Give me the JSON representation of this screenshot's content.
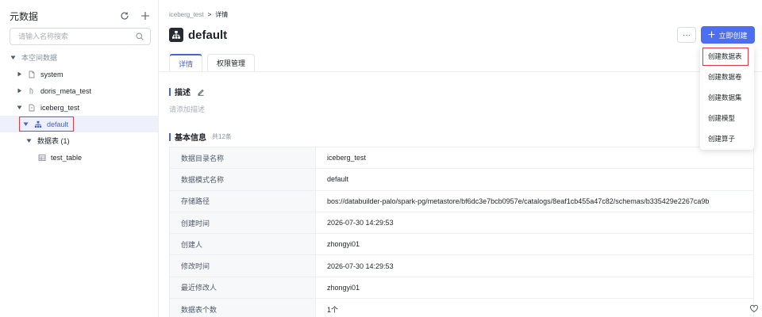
{
  "sidebar": {
    "title": "元数据",
    "search_placeholder": "请输入名称搜索",
    "tree": {
      "section_label": "本空间数据",
      "catalogs": [
        {
          "label": "system"
        },
        {
          "label": "doris_meta_test"
        },
        {
          "label": "iceberg_test"
        }
      ],
      "schema_label": "default",
      "folder_label": "数据表 (1)",
      "table_label": "test_table"
    }
  },
  "breadcrumb": {
    "parent": "iceberg_test",
    "separator": ">",
    "current": "详情"
  },
  "page": {
    "title": "default",
    "more_label": "···",
    "create_label": "立即创建"
  },
  "tabs": [
    {
      "label": "详情",
      "active": true
    },
    {
      "label": "权限管理",
      "active": false
    }
  ],
  "description": {
    "title": "描述",
    "placeholder": "请添加描述"
  },
  "basic_info": {
    "title": "基本信息",
    "count_label": "共12条",
    "rows": [
      {
        "key": "数据目录名称",
        "value": "iceberg_test"
      },
      {
        "key": "数据模式名称",
        "value": "default"
      },
      {
        "key": "存储路径",
        "value": "bos://databuilder-palo/spark-pg/metastore/bf6dc3e7bcb0957e/catalogs/8eaf1cb455a47c82/schemas/b335429e2267ca9b"
      },
      {
        "key": "创建时间",
        "value": "2026-07-30 14:29:53"
      },
      {
        "key": "创建人",
        "value": "zhongyi01"
      },
      {
        "key": "修改时间",
        "value": "2026-07-30 14:29:53"
      },
      {
        "key": "最近修改人",
        "value": "zhongyi01"
      },
      {
        "key": "数据表个数",
        "value": "1个"
      }
    ]
  },
  "create_menu": {
    "items": [
      "创建数据表",
      "创建数据卷",
      "创建数据集",
      "创建模型",
      "创建算子"
    ]
  },
  "colors": {
    "accent": "#4e6ef2",
    "active_text": "#4761d7",
    "highlight_border": "#e0393e"
  }
}
